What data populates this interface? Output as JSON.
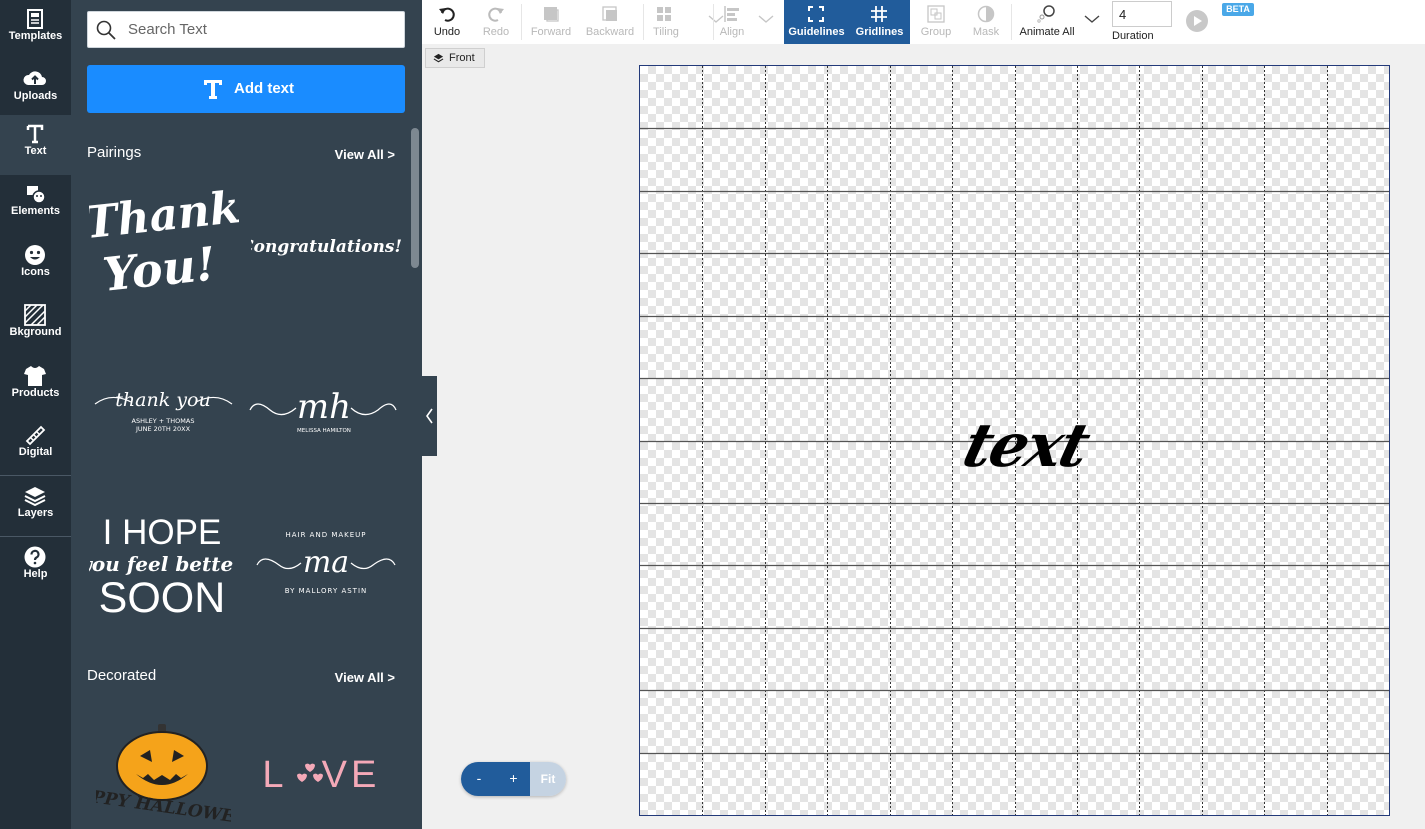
{
  "rail": {
    "items": [
      {
        "label": "Templates",
        "icon": "templates-icon"
      },
      {
        "label": "Uploads",
        "icon": "upload-cloud-icon"
      },
      {
        "label": "Text",
        "icon": "text-t-icon",
        "active": true
      },
      {
        "label": "Elements",
        "icon": "elements-icon"
      },
      {
        "label": "Icons",
        "icon": "smiley-icon"
      },
      {
        "label": "Bkground",
        "icon": "background-hatch-icon"
      },
      {
        "label": "Products",
        "icon": "tshirt-icon"
      },
      {
        "label": "Digital",
        "icon": "ruler-icon"
      },
      {
        "label": "Layers",
        "icon": "layers-icon"
      },
      {
        "label": "Help",
        "icon": "help-icon"
      }
    ]
  },
  "panel": {
    "search_placeholder": "Search Text",
    "add_text_label": "Add text",
    "sections": [
      {
        "title": "Pairings",
        "view_all": "View All >",
        "thumbs": [
          {
            "lines": [
              "Thank",
              "You!"
            ]
          },
          {
            "lines": [
              "Congratulations!"
            ]
          },
          {
            "lines": [
              "thank you",
              "ASHLEY + THOMAS",
              "JUNE 20TH 20XX"
            ]
          },
          {
            "lines": [
              "mh",
              "MELISSA HAMILTON"
            ]
          },
          {
            "lines": [
              "I HOPE",
              "you feel better",
              "SOON"
            ]
          },
          {
            "lines": [
              "HAIR AND MAKEUP",
              "ma",
              "BY MALLORY ASTIN"
            ]
          }
        ]
      },
      {
        "title": "Decorated",
        "view_all": "View All >",
        "thumbs": [
          {
            "lines": [
              "HAPPY HALLOWEEN"
            ]
          },
          {
            "lines": [
              "L",
              "VE"
            ]
          }
        ]
      }
    ]
  },
  "toolbar": {
    "undo": "Undo",
    "redo": "Redo",
    "forward": "Forward",
    "backward": "Backward",
    "tiling": "Tiling",
    "align": "Align",
    "guidelines": "Guidelines",
    "gridlines": "Gridlines",
    "group": "Group",
    "mask": "Mask",
    "animate_all": "Animate All",
    "duration_value": "4",
    "duration_label": "Duration",
    "beta": "BETA"
  },
  "front_label": "Front",
  "canvas": {
    "text": "text",
    "grid_columns": 12,
    "grid_rows": 12
  },
  "zoom": {
    "minus": "-",
    "plus": "+",
    "fit": "Fit"
  },
  "colors": {
    "rail_bg": "#232f39",
    "panel_bg": "#34434f",
    "accent_blue": "#1a8cff",
    "toolbar_active": "#215c9b"
  }
}
